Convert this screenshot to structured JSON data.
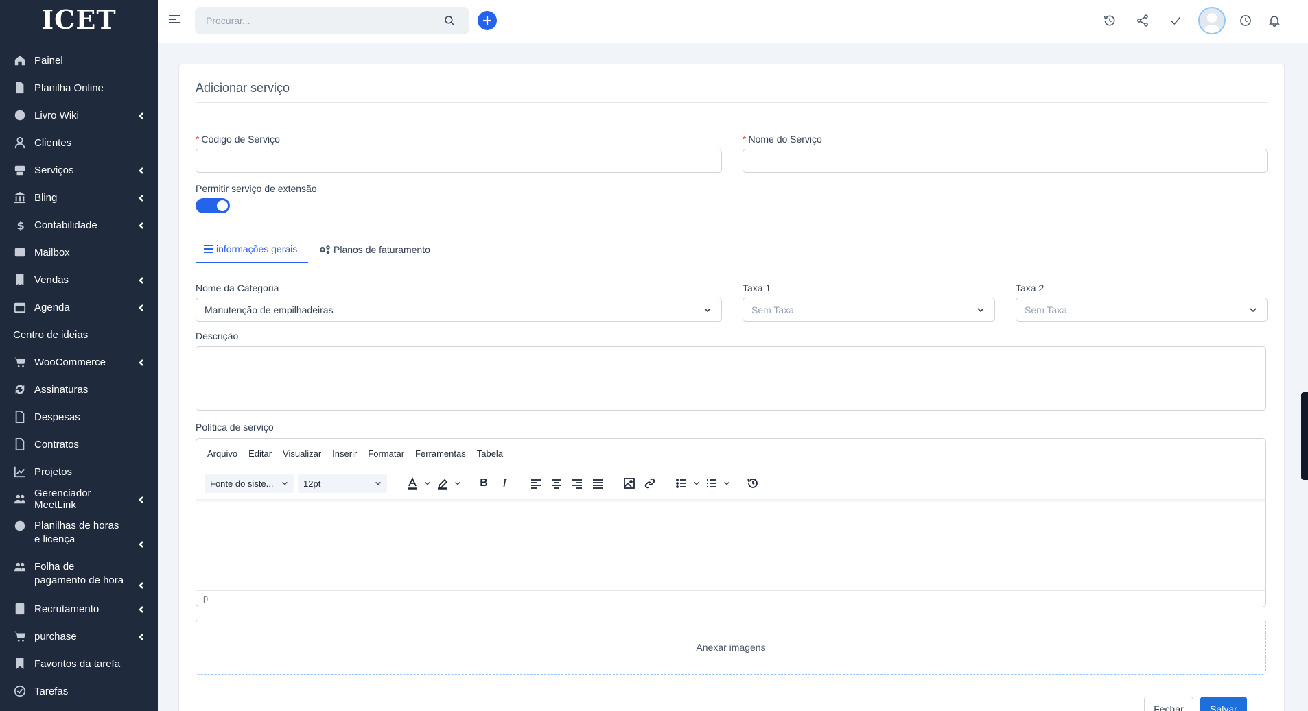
{
  "brand": {
    "logo": "ICET"
  },
  "sidebar": {
    "items": [
      {
        "label": "Painel",
        "icon": "home-icon",
        "chevron": false
      },
      {
        "label": "Planilha Online",
        "icon": "file-icon",
        "chevron": false
      },
      {
        "label": "Livro Wiki",
        "icon": "question-icon",
        "chevron": true
      },
      {
        "label": "Clientes",
        "icon": "user-icon",
        "chevron": false
      },
      {
        "label": "Serviços",
        "icon": "services-icon",
        "chevron": true
      },
      {
        "label": "Bling",
        "icon": "bank-icon",
        "chevron": true
      },
      {
        "label": "Contabilidade",
        "icon": "dollar-icon",
        "chevron": true
      },
      {
        "label": "Mailbox",
        "icon": "mail-icon",
        "chevron": false
      },
      {
        "label": "Vendas",
        "icon": "receipt-icon",
        "chevron": true
      },
      {
        "label": "Agenda",
        "icon": "calendar-icon",
        "chevron": true
      },
      {
        "label": "Centro de ideias",
        "icon": "",
        "chevron": false
      },
      {
        "label": "WooCommerce",
        "icon": "cart-icon",
        "chevron": true
      },
      {
        "label": "Assinaturas",
        "icon": "refresh-icon",
        "chevron": false
      },
      {
        "label": "Despesas",
        "icon": "document-icon",
        "chevron": false
      },
      {
        "label": "Contratos",
        "icon": "contract-icon",
        "chevron": false
      },
      {
        "label": "Projetos",
        "icon": "chart-icon",
        "chevron": false
      },
      {
        "label": "Gerenciador MeetLink",
        "icon": "users-icon",
        "chevron": true
      },
      {
        "label": "Planilhas de horas e licença",
        "icon": "user-circle-icon",
        "chevron": true,
        "tall": true
      },
      {
        "label": "Folha de pagamento de hora",
        "icon": "users-icon",
        "chevron": true,
        "tall": true
      },
      {
        "label": "Recrutamento",
        "icon": "id-card-icon",
        "chevron": true
      },
      {
        "label": "purchase",
        "icon": "cart-icon",
        "chevron": true
      },
      {
        "label": "Favoritos da tarefa",
        "icon": "bookmark-icon",
        "chevron": false
      },
      {
        "label": "Tarefas",
        "icon": "check-circle-icon",
        "chevron": false
      }
    ]
  },
  "header": {
    "search_placeholder": "Procurar..."
  },
  "form": {
    "title": "Adicionar serviço",
    "service_code_label": "Código de Serviço",
    "service_name_label": "Nome do Serviço",
    "extension_label": "Permitir serviço de extensão",
    "extension_enabled": true,
    "required_mark": "*",
    "tabs": [
      {
        "label": "informações gerais",
        "active": true
      },
      {
        "label": "Planos de faturamento",
        "active": false
      }
    ],
    "category_label": "Nome da Categoria",
    "category_value": "Manutenção de empilhadeiras",
    "tax1_label": "Taxa 1",
    "tax1_value": "Sem Taxa",
    "tax2_label": "Taxa 2",
    "tax2_value": "Sem Taxa",
    "description_label": "Descrição",
    "policy_label": "Política de serviço",
    "attach_label": "Anexar imagens",
    "close_label": "Fechar",
    "save_label": "Salvar"
  },
  "editor": {
    "menu": [
      "Arquivo",
      "Editar",
      "Visualizar",
      "Inserir",
      "Formatar",
      "Ferramentas",
      "Tabela"
    ],
    "font_family": "Fonte do siste...",
    "font_size": "12pt",
    "status_path": "p"
  },
  "colors": {
    "accent": "#2563eb",
    "sidebar_bg": "#1f2a3d"
  }
}
